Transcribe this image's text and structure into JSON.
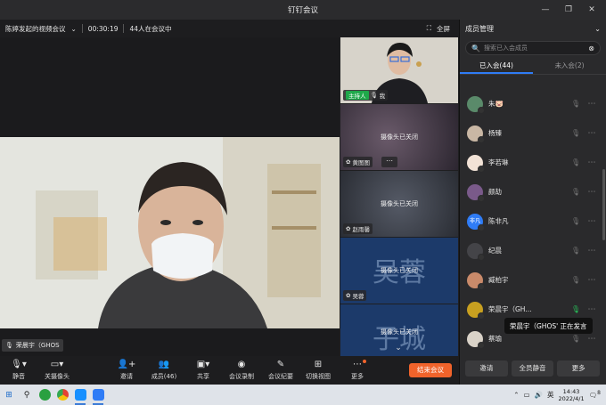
{
  "window": {
    "title": "钉钉会议"
  },
  "meeting": {
    "name": "陈婷发起的视频会议",
    "duration": "00:30:19",
    "attendance": "44人在会议中",
    "fullscreen_label": "全屏"
  },
  "main_video": {
    "speaker_name": "荣晨宇（GHOS"
  },
  "thumbnails": [
    {
      "badge": "主持人",
      "name": "我",
      "camera_off": ""
    },
    {
      "badge": "",
      "name": "黄图图",
      "camera_off": "摄像头已关闭"
    },
    {
      "badge": "",
      "name": "赵雨馨",
      "camera_off": "摄像头已关闭"
    },
    {
      "badge": "",
      "name": "吴蓉",
      "camera_off": "摄像头已关闭",
      "bg_text": "吴蓉"
    },
    {
      "badge": "",
      "name": "",
      "camera_off": "摄像头已关闭",
      "bg_text": "子城"
    }
  ],
  "panel": {
    "title": "成员管理",
    "search_placeholder": "搜索已入会成员",
    "tab_joined": "已入会(44)",
    "tab_not_joined": "未入会(2)",
    "members": [
      {
        "name": "朱🐷",
        "avatar_color": "#5a8a6a",
        "avatar_text": "",
        "mic_on": false
      },
      {
        "name": "杨臻",
        "avatar_color": "#c9b7a4",
        "avatar_text": "",
        "mic_on": false
      },
      {
        "name": "李若琳",
        "avatar_color": "#f2e2d6",
        "avatar_text": "",
        "mic_on": false
      },
      {
        "name": "颜劼",
        "avatar_color": "#7a5a8a",
        "avatar_text": "",
        "mic_on": false
      },
      {
        "name": "陈非凡",
        "avatar_color": "#2f7cf6",
        "avatar_text": "非凡",
        "mic_on": false
      },
      {
        "name": "纪晨",
        "avatar_color": "#444448",
        "avatar_text": "",
        "mic_on": false
      },
      {
        "name": "臧柏宇",
        "avatar_color": "#c98a6a",
        "avatar_text": "",
        "mic_on": false
      },
      {
        "name": "荣晨宇（GH...",
        "avatar_color": "#c8a020",
        "avatar_text": "",
        "mic_on": true
      },
      {
        "name": "蔡瑜",
        "avatar_color": "#d9d2c8",
        "avatar_text": "",
        "mic_on": false
      }
    ],
    "speaking_tip": "荣晨宇（GHOS' 正在发言",
    "footer": {
      "invite": "邀请",
      "mute_all": "全员静音",
      "more": "更多"
    }
  },
  "toolbar": {
    "mute": "静音",
    "camera_off": "关摄像头",
    "invite": "邀请",
    "members": "成员(46)",
    "share": "共享",
    "record": "会议录制",
    "minutes": "会议纪要",
    "switch_view": "切换视图",
    "more": "更多",
    "end_meeting": "结束会议"
  },
  "taskbar": {
    "ime": "英",
    "time": "14:43",
    "date": "2022/4/1",
    "notifications": "8"
  }
}
